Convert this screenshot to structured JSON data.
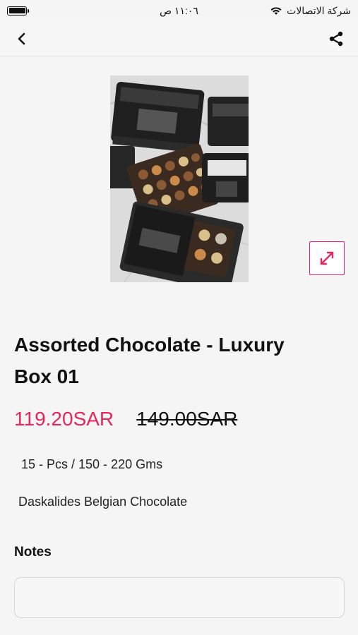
{
  "status_bar": {
    "carrier": "شركة الاتصالات",
    "time": "١١:٠٦ ص"
  },
  "nav": {
    "back_icon": "chevron-left-icon",
    "share_icon": "share-icon"
  },
  "product": {
    "image_icon": "product-photo",
    "expand_icon": "expand-icon",
    "title": "Assorted Chocolate - Luxury Box 01",
    "sale_price": "119.20SAR",
    "original_price": "149.00SAR",
    "spec": "15 - Pcs / 150 - 220 Gms",
    "brand": "Daskalides Belgian Chocolate"
  },
  "notes": {
    "label": "Notes",
    "value": "",
    "placeholder": ""
  },
  "colors": {
    "accent": "#e8265e",
    "background": "#f5f5f5"
  }
}
